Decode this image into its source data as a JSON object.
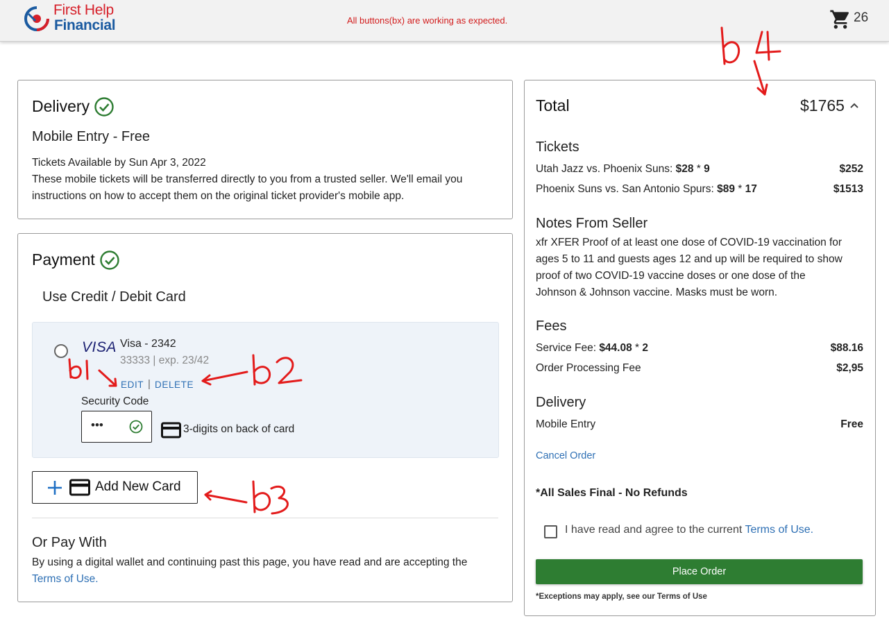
{
  "header": {
    "logo_line1": "First Help",
    "logo_line2": "Financial",
    "notice": "All buttons(bx) are working as expected.",
    "cart_count": "26"
  },
  "delivery": {
    "title": "Delivery",
    "method": "Mobile Entry - Free",
    "line1": "Tickets Available by Sun Apr 3, 2022",
    "line2": "These mobile tickets will be transferred directly to you from a trusted seller. We'll email you",
    "line3": "instructions on how to accept them on the original ticket provider's mobile app."
  },
  "payment": {
    "title": "Payment",
    "method": "Use Credit / Debit Card",
    "card": {
      "brand": "VISA",
      "name": "Visa - 2342",
      "details": "33333 | exp. 23/42",
      "edit": "EDIT",
      "separator": "|",
      "delete": "DELETE"
    },
    "security_label": "Security Code",
    "security_value": "•••",
    "security_hint": "3-digits on back of card",
    "add_card": "Add New Card",
    "or_pay_title": "Or Pay With",
    "or_pay_text": "By using a digital wallet and continuing past this page, you have read and are accepting the",
    "terms_link": "Terms of Use."
  },
  "summary": {
    "total_label": "Total",
    "total_value": "$1765",
    "tickets_title": "Tickets",
    "tickets": [
      {
        "event": "Utah Jazz vs. Phoenix Suns: ",
        "price": "$28",
        "times": " * ",
        "qty": "9",
        "total": "$252"
      },
      {
        "event": "Phoenix Suns vs. San Antonio Spurs: ",
        "price": "$89",
        "times": " * ",
        "qty": "17",
        "total": "$1513"
      }
    ],
    "notes_title": "Notes From Seller",
    "notes": [
      "xfr XFER Proof of at least one dose of COVID-19 vaccination for",
      "ages 5 to 11 and guests ages 12 and up will be required to show",
      "proof of two COVID-19 vaccine doses or one dose of the",
      "Johnson & Johnson vaccine. Masks must be worn."
    ],
    "fees_title": "Fees",
    "service_fee_label": "Service Fee: ",
    "service_fee_price": "$44.08",
    "service_fee_times": " * ",
    "service_fee_qty": "2",
    "service_fee_total": "$88.16",
    "processing_label": "Order Processing Fee",
    "processing_total": "$2,95",
    "delivery_title": "Delivery",
    "delivery_method": "Mobile Entry",
    "delivery_price": "Free",
    "cancel": "Cancel Order",
    "final_notice": "*All Sales Final - No Refunds",
    "agree_text": "I have read and agree to the current ",
    "agree_link": "Terms of Use.",
    "place_order": "Place Order",
    "exceptions": "*Exceptions may apply, see our Terms of Use"
  },
  "annotations": {
    "b1": "b1",
    "b2": "b2",
    "b3": "b3",
    "b4": "b4"
  },
  "colors": {
    "accent_green": "#2e7d32",
    "check_green": "#2e7d32",
    "link_blue": "#2d6fb4",
    "notice_red": "#d21c1c",
    "annotation_red": "#e31b1b"
  }
}
